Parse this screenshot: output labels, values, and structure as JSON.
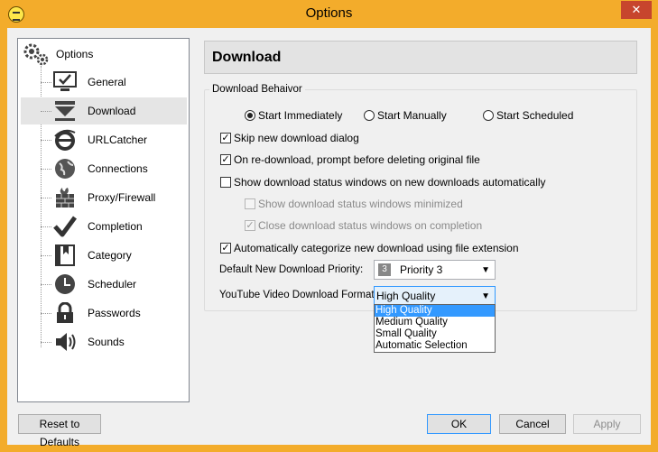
{
  "window": {
    "title": "Options",
    "close_glyph": "✕"
  },
  "tree": {
    "root_label": "Options",
    "root_icon": "gears-icon",
    "items": [
      {
        "label": "General",
        "icon": "monitor-check-icon"
      },
      {
        "label": "Download",
        "icon": "download-arrow-icon",
        "selected": true
      },
      {
        "label": "URLCatcher",
        "icon": "ie-logo-icon"
      },
      {
        "label": "Connections",
        "icon": "globe-icon"
      },
      {
        "label": "Proxy/Firewall",
        "icon": "firewall-icon"
      },
      {
        "label": "Completion",
        "icon": "checkmark-icon"
      },
      {
        "label": "Category",
        "icon": "category-book-icon"
      },
      {
        "label": "Scheduler",
        "icon": "clock-icon"
      },
      {
        "label": "Passwords",
        "icon": "padlock-icon"
      },
      {
        "label": "Sounds",
        "icon": "speaker-icon"
      }
    ]
  },
  "panel": {
    "header": "Download",
    "group_title": "Download Behaivor",
    "radios": [
      {
        "label": "Start Immediately",
        "checked": true
      },
      {
        "label": "Start Manually",
        "checked": false
      },
      {
        "label": "Start Scheduled",
        "checked": false
      }
    ],
    "checkboxes": [
      {
        "label": "Skip new download dialog",
        "checked": true,
        "disabled": false
      },
      {
        "label": "On re-download, prompt before deleting original file",
        "checked": true,
        "disabled": false
      },
      {
        "label": "Show download status windows on new downloads automatically",
        "checked": false,
        "disabled": false
      },
      {
        "label": "Show download status windows minimized",
        "checked": false,
        "disabled": true
      },
      {
        "label": "Close download status windows on completion",
        "checked": true,
        "disabled": true
      },
      {
        "label": "Automatically categorize new download using file extension",
        "checked": true,
        "disabled": false
      }
    ],
    "priority": {
      "label": "Default New Download Priority:",
      "badge": "3",
      "value": "Priority 3"
    },
    "youtube": {
      "label": "YouTube Video Download Format:",
      "value": "High Quality",
      "options": [
        "High Quality",
        "Medium Quality",
        "Small Quality",
        "Automatic Selection"
      ],
      "highlighted": 0
    }
  },
  "buttons": {
    "reset": "Reset to Defaults",
    "ok": "OK",
    "cancel": "Cancel",
    "apply": "Apply"
  },
  "colors": {
    "titlebar": "#f3ac2b",
    "close": "#c7452d",
    "highlight": "#3399ff"
  }
}
